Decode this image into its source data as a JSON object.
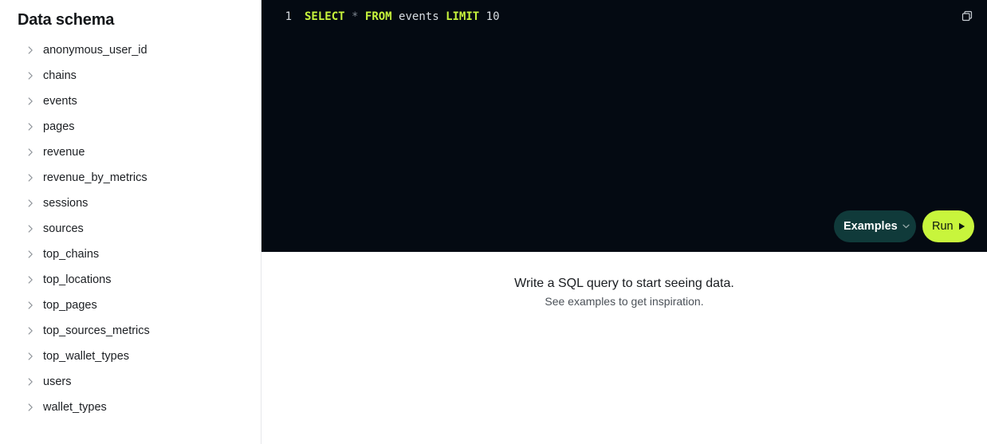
{
  "sidebar": {
    "title": "Data schema",
    "items": [
      {
        "label": "anonymous_user_id"
      },
      {
        "label": "chains"
      },
      {
        "label": "events"
      },
      {
        "label": "pages"
      },
      {
        "label": "revenue"
      },
      {
        "label": "revenue_by_metrics"
      },
      {
        "label": "sessions"
      },
      {
        "label": "sources"
      },
      {
        "label": "top_chains"
      },
      {
        "label": "top_locations"
      },
      {
        "label": "top_pages"
      },
      {
        "label": "top_sources_metrics"
      },
      {
        "label": "top_wallet_types"
      },
      {
        "label": "users"
      },
      {
        "label": "wallet_types"
      }
    ],
    "item_icon": "chevron-right-icon"
  },
  "editor": {
    "line_number": "1",
    "query_tokens": {
      "select": "SELECT",
      "star": "*",
      "from": "FROM",
      "table": "events",
      "limit": "LIMIT",
      "count": "10"
    },
    "copy_icon": "copy-icon",
    "background": "#040a12",
    "keyword_color": "#c8f53c"
  },
  "actions": {
    "examples_label": "Examples",
    "examples_icon": "chevron-down-icon",
    "run_label": "Run",
    "run_icon": "play-icon",
    "examples_color": "#103a3a",
    "run_color": "#c8f53c"
  },
  "results": {
    "empty_title": "Write a SQL query to start seeing data.",
    "empty_subtitle": "See examples to get inspiration."
  }
}
